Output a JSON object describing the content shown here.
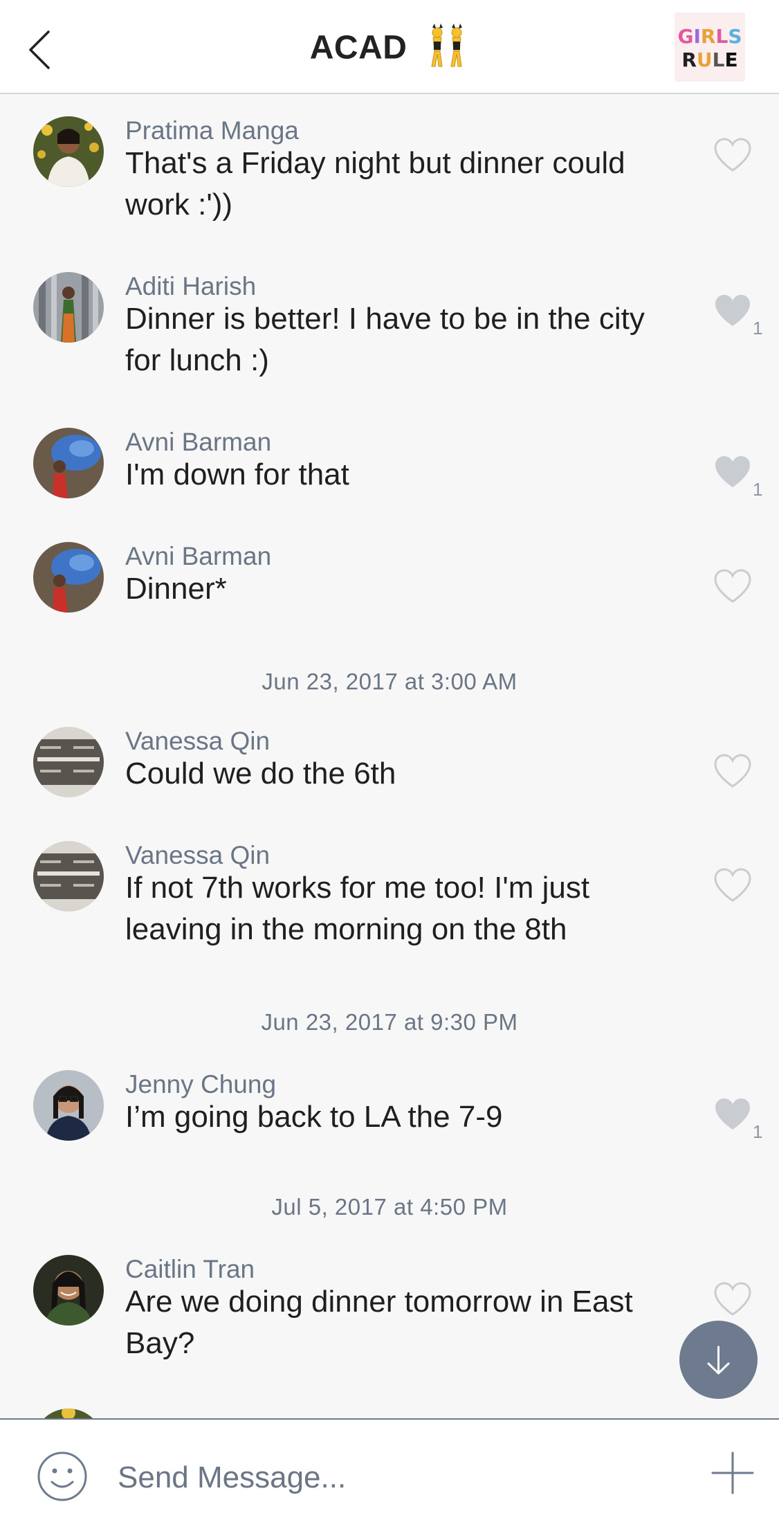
{
  "header": {
    "title": "ACAD",
    "title_emoji": "dancers-emoji",
    "group_avatar_text": "GIRLS RULE"
  },
  "messages": [
    {
      "sender": "Pratima Manga",
      "text": "That's a Friday night but dinner could work :'))",
      "liked": false,
      "like_count": ""
    },
    {
      "sender": "Aditi Harish",
      "text": "Dinner is better! I have to be in the city for lunch :)",
      "liked": true,
      "like_count": "1"
    },
    {
      "sender": "Avni Barman",
      "text": "I'm down for that",
      "liked": true,
      "like_count": "1"
    },
    {
      "sender": "Avni Barman",
      "text": "Dinner*",
      "liked": false,
      "like_count": ""
    },
    {
      "sender": "Vanessa Qin",
      "text": "Could we do the 6th",
      "liked": false,
      "like_count": ""
    },
    {
      "sender": "Vanessa Qin",
      "text": "If not 7th works for me too! I'm just leaving in the morning on the 8th",
      "liked": false,
      "like_count": ""
    },
    {
      "sender": "Jenny Chung",
      "text": "I’m going back to LA the 7-9",
      "liked": true,
      "like_count": "1"
    },
    {
      "sender": "Caitlin Tran",
      "text": "Are we doing dinner tomorrow in East Bay?",
      "liked": false,
      "like_count": ""
    }
  ],
  "dates": [
    "Jun 23, 2017 at 3:00 AM",
    "Jun 23, 2017 at 9:30 PM",
    "Jul 5, 2017 at 4:50 PM"
  ],
  "composer": {
    "placeholder": "Send Message..."
  },
  "colors": {
    "accent": "#6e7b8f",
    "sender": "#6a7585",
    "like_filled": "#c9ccd1",
    "like_outline": "#c9ccd1"
  }
}
